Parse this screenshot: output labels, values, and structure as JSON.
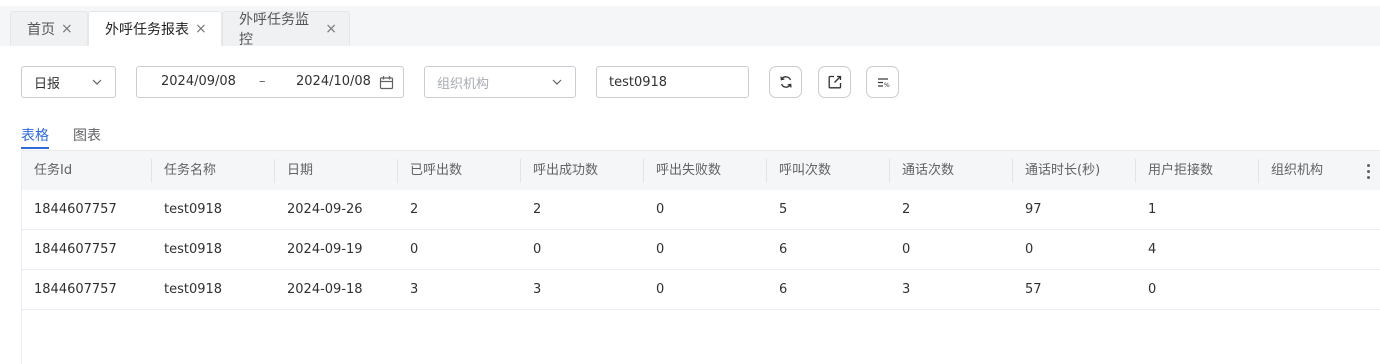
{
  "tabs": [
    {
      "label": "首页"
    },
    {
      "label": "外呼任务报表"
    },
    {
      "label": "外呼任务监控"
    }
  ],
  "filters": {
    "period_value": "日报",
    "date_start": "2024/09/08",
    "date_sep": "–",
    "date_end": "2024/10/08",
    "org_placeholder": "组织机构",
    "task_name_value": "test0918"
  },
  "views": {
    "table_label": "表格",
    "chart_label": "图表"
  },
  "table": {
    "columns": [
      "任务Id",
      "任务名称",
      "日期",
      "已呼出数",
      "呼出成功数",
      "呼出失败数",
      "呼叫次数",
      "通话次数",
      "通话时长(秒)",
      "用户拒接数",
      "组织机构"
    ],
    "rows": [
      [
        "1844607757",
        "test0918",
        "2024-09-26",
        "2",
        "2",
        "0",
        "5",
        "2",
        "97",
        "1",
        ""
      ],
      [
        "1844607757",
        "test0918",
        "2024-09-19",
        "0",
        "0",
        "0",
        "6",
        "0",
        "0",
        "4",
        ""
      ],
      [
        "1844607757",
        "test0918",
        "2024-09-18",
        "3",
        "3",
        "0",
        "6",
        "3",
        "57",
        "0",
        ""
      ]
    ]
  },
  "colors": {
    "accent": "#2f6bd8"
  }
}
